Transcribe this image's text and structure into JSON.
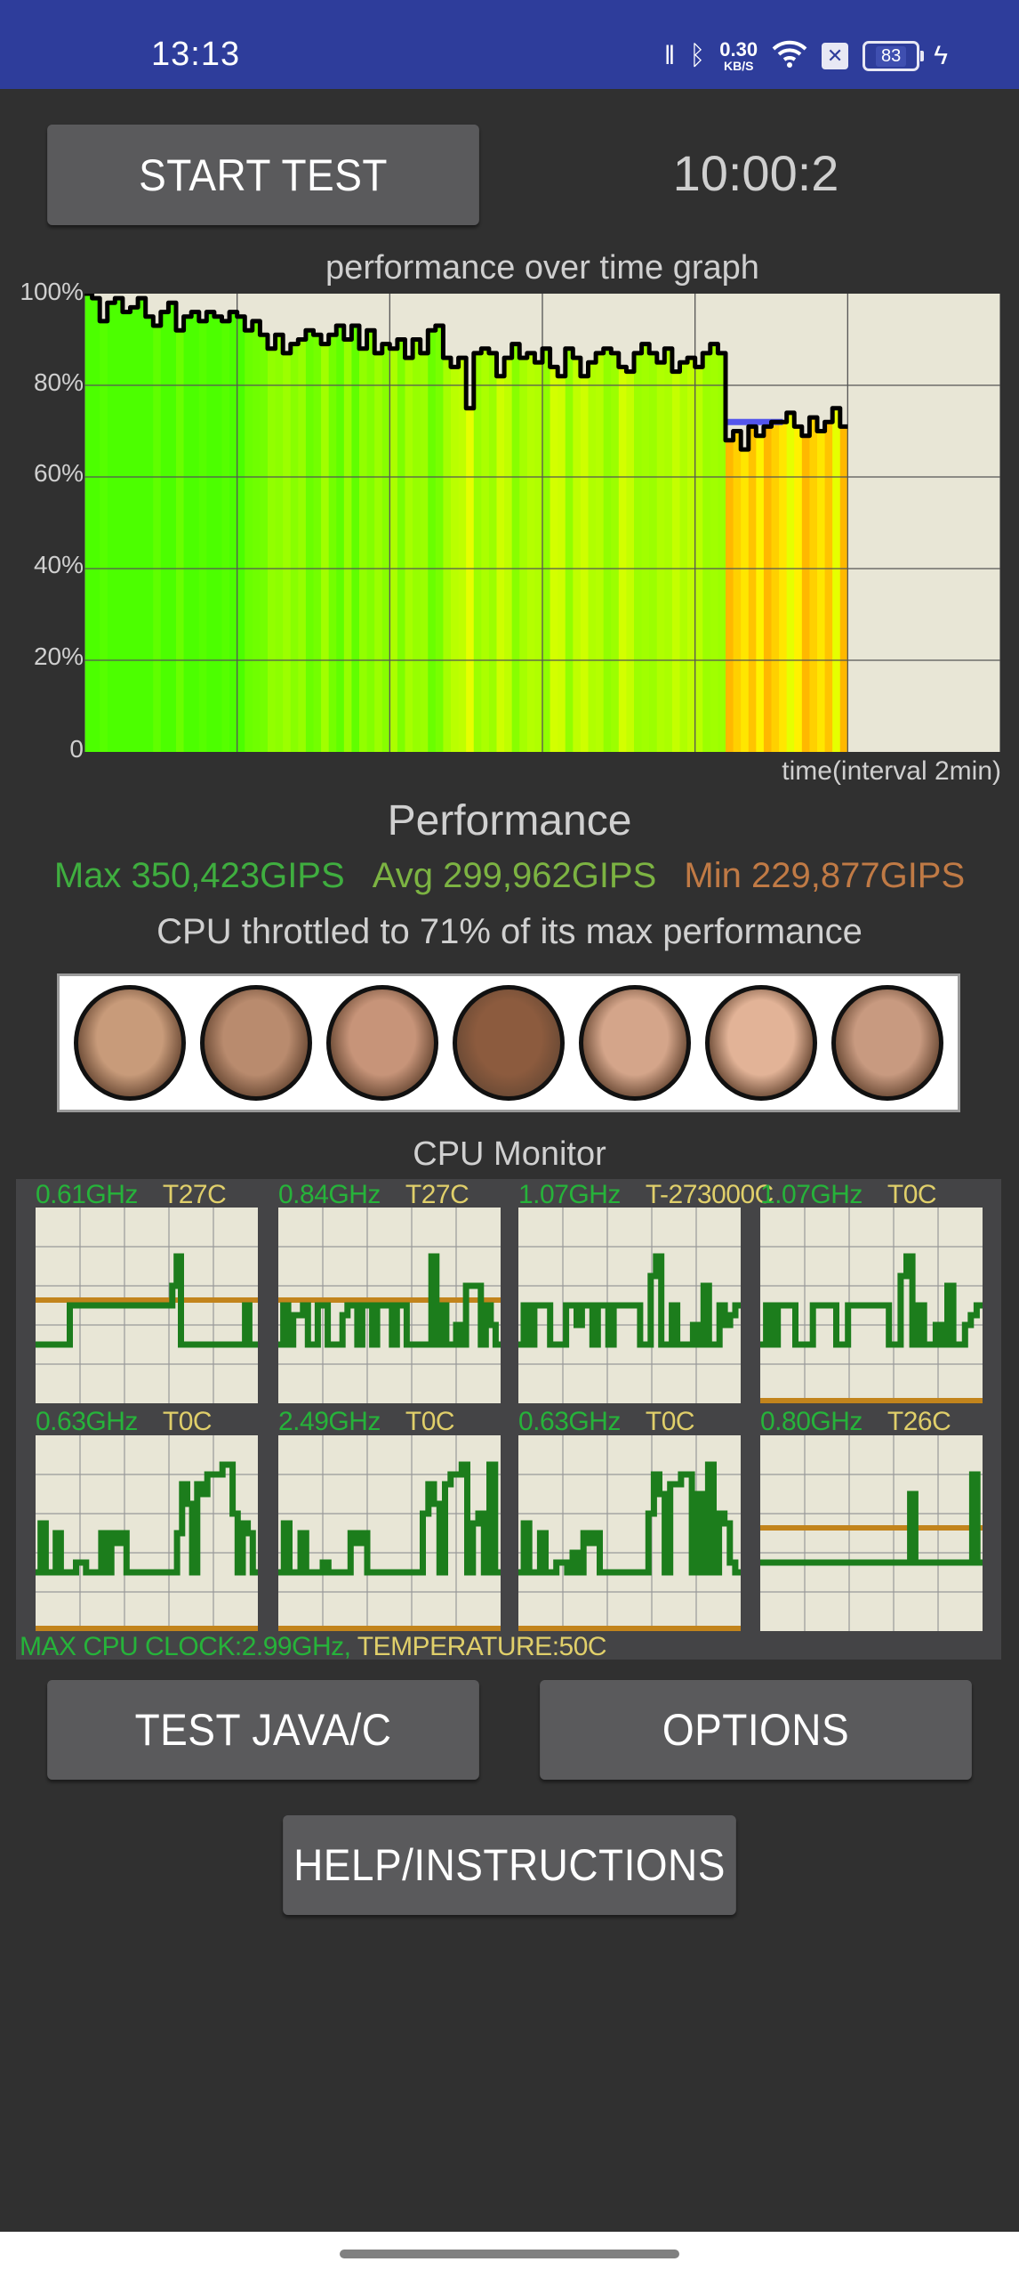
{
  "status_bar": {
    "time": "13:13",
    "net_speed_value": "0.30",
    "net_speed_unit": "KB/S",
    "battery": "83",
    "icons": [
      "vibrate-icon",
      "bluetooth-icon",
      "wifi-icon",
      "sim-x-icon",
      "battery-icon",
      "charging-bolt-icon"
    ]
  },
  "controls": {
    "start_label": "START TEST",
    "timer": "10:00:2"
  },
  "graph": {
    "title": "performance over time graph",
    "xlabel": "time(interval 2min)"
  },
  "chart_data": [
    {
      "type": "area",
      "title": "performance over time graph",
      "xlabel": "time(interval 2min)",
      "ylabel": "",
      "y_ticks": [
        "0",
        "20%",
        "40%",
        "60%",
        "80%",
        "100%"
      ],
      "ylim": [
        0,
        100
      ],
      "xlim_minutes": [
        0,
        12
      ],
      "grid": true,
      "x_minutes": [
        0,
        0.1,
        0.2,
        0.3,
        0.4,
        0.5,
        0.6,
        0.7,
        0.8,
        0.9,
        1.0,
        1.1,
        1.2,
        1.3,
        1.4,
        1.5,
        1.6,
        1.7,
        1.8,
        1.9,
        2.0,
        2.1,
        2.2,
        2.3,
        2.4,
        2.5,
        2.6,
        2.7,
        2.8,
        2.9,
        3.0,
        3.1,
        3.2,
        3.3,
        3.4,
        3.5,
        3.6,
        3.7,
        3.8,
        3.9,
        4.0,
        4.1,
        4.2,
        4.3,
        4.4,
        4.5,
        4.6,
        4.7,
        4.8,
        4.9,
        5.0,
        5.1,
        5.2,
        5.3,
        5.4,
        5.5,
        5.6,
        5.7,
        5.8,
        5.9,
        6.0,
        6.1,
        6.2,
        6.3,
        6.4,
        6.5,
        6.6,
        6.7,
        6.8,
        6.9,
        7.0,
        7.1,
        7.2,
        7.3,
        7.4,
        7.5,
        7.6,
        7.7,
        7.8,
        7.9,
        8.0,
        8.1,
        8.2,
        8.3,
        8.4,
        8.5,
        8.6,
        8.7,
        8.8,
        8.9,
        9.0,
        9.1,
        9.2,
        9.3,
        9.4,
        9.5,
        9.6,
        9.7,
        9.8,
        9.9
      ],
      "performance_percent": [
        100,
        99,
        94,
        98,
        99,
        96,
        97,
        99,
        95,
        93,
        96,
        98,
        92,
        95,
        96,
        94,
        96,
        95,
        94,
        96,
        95,
        92,
        94,
        91,
        88,
        91,
        87,
        89,
        90,
        92,
        91,
        89,
        91,
        93,
        90,
        93,
        88,
        92,
        87,
        89,
        88,
        90,
        86,
        90,
        87,
        92,
        93,
        86,
        84,
        86,
        75,
        87,
        88,
        87,
        82,
        86,
        89,
        86,
        87,
        85,
        88,
        84,
        82,
        88,
        86,
        82,
        85,
        87,
        88,
        87,
        84,
        83,
        87,
        89,
        87,
        85,
        88,
        83,
        85,
        86,
        84,
        87,
        89,
        87,
        68,
        70,
        66,
        71,
        69,
        71,
        72,
        72,
        74,
        71,
        69,
        73,
        70,
        72,
        75,
        71
      ],
      "throttled_average_percent": 72,
      "bar_color_hint": [
        "green",
        "yellow-green",
        "yellow",
        "orange"
      ]
    },
    {
      "type": "line",
      "title": "CPU Monitor",
      "cores": [
        {
          "freq": "0.61GHz",
          "temp": "T27C",
          "temp_level": 0.5,
          "freq_series": [
            0.3,
            0.3,
            0.3,
            0.3,
            0.3,
            0.3,
            0.3,
            0.3,
            0.5,
            0.5,
            0.5,
            0.5,
            0.5,
            0.5,
            0.5,
            0.5,
            0.5,
            0.5,
            0.5,
            0.5,
            0.5,
            0.5,
            0.5,
            0.5,
            0.5,
            0.5,
            0.5,
            0.5,
            0.5,
            0.5,
            0.5,
            0.5,
            0.6,
            0.75,
            0.3,
            0.3,
            0.3,
            0.3,
            0.3,
            0.3,
            0.3,
            0.3,
            0.3,
            0.3,
            0.3,
            0.3,
            0.3,
            0.3,
            0.3,
            0.5,
            0.3,
            0.3
          ]
        },
        {
          "freq": "0.84GHz",
          "temp": "T27C",
          "temp_level": 0.5,
          "freq_series": [
            0.3,
            0.5,
            0.3,
            0.45,
            0.45,
            0.5,
            0.3,
            0.3,
            0.5,
            0.5,
            0.3,
            0.3,
            0.3,
            0.45,
            0.5,
            0.5,
            0.3,
            0.5,
            0.5,
            0.3,
            0.5,
            0.5,
            0.5,
            0.3,
            0.5,
            0.5,
            0.3,
            0.3,
            0.3,
            0.3,
            0.3,
            0.75,
            0.3,
            0.5,
            0.3,
            0.3,
            0.4,
            0.3,
            0.6,
            0.6,
            0.6,
            0.3,
            0.5,
            0.4,
            0.3
          ]
        },
        {
          "freq": "1.07GHz",
          "temp": "T-273000C",
          "temp_level": null,
          "freq_series": [
            0.3,
            0.5,
            0.3,
            0.5,
            0.5,
            0.5,
            0.3,
            0.3,
            0.3,
            0.5,
            0.5,
            0.4,
            0.5,
            0.5,
            0.3,
            0.5,
            0.5,
            0.3,
            0.5,
            0.5,
            0.5,
            0.5,
            0.5,
            0.3,
            0.3,
            0.65,
            0.75,
            0.3,
            0.3,
            0.5,
            0.3,
            0.3,
            0.3,
            0.4,
            0.3,
            0.6,
            0.3,
            0.3,
            0.5,
            0.4,
            0.45,
            0.5
          ]
        },
        {
          "freq": "1.07GHz",
          "temp": "T0C",
          "temp_level": 0.0,
          "freq_series": [
            0.3,
            0.5,
            0.3,
            0.5,
            0.5,
            0.5,
            0.3,
            0.3,
            0.3,
            0.5,
            0.5,
            0.5,
            0.5,
            0.3,
            0.3,
            0.5,
            0.5,
            0.5,
            0.5,
            0.5,
            0.5,
            0.5,
            0.3,
            0.3,
            0.65,
            0.75,
            0.3,
            0.5,
            0.3,
            0.3,
            0.4,
            0.3,
            0.6,
            0.3,
            0.3,
            0.4,
            0.45,
            0.5
          ]
        },
        {
          "freq": "0.63GHz",
          "temp": "T0C",
          "temp_level": 0.0,
          "freq_series": [
            0.3,
            0.55,
            0.3,
            0.3,
            0.5,
            0.3,
            0.3,
            0.3,
            0.35,
            0.35,
            0.3,
            0.3,
            0.3,
            0.5,
            0.3,
            0.5,
            0.45,
            0.5,
            0.3,
            0.3,
            0.3,
            0.3,
            0.3,
            0.3,
            0.3,
            0.3,
            0.3,
            0.3,
            0.5,
            0.75,
            0.65,
            0.3,
            0.75,
            0.7,
            0.8,
            0.8,
            0.8,
            0.85,
            0.85,
            0.6,
            0.3,
            0.55,
            0.5,
            0.3
          ]
        },
        {
          "freq": "2.49GHz",
          "temp": "T0C",
          "temp_level": 0.0,
          "freq_series": [
            0.3,
            0.55,
            0.3,
            0.3,
            0.5,
            0.3,
            0.3,
            0.3,
            0.35,
            0.3,
            0.3,
            0.3,
            0.3,
            0.5,
            0.45,
            0.5,
            0.3,
            0.3,
            0.3,
            0.3,
            0.3,
            0.3,
            0.3,
            0.3,
            0.3,
            0.3,
            0.6,
            0.75,
            0.65,
            0.3,
            0.75,
            0.8,
            0.8,
            0.85,
            0.3,
            0.55,
            0.6,
            0.3,
            0.85,
            0.3
          ]
        },
        {
          "freq": "0.63GHz",
          "temp": "T0C",
          "temp_level": 0.0,
          "freq_series": [
            0.3,
            0.55,
            0.3,
            0.3,
            0.5,
            0.3,
            0.3,
            0.35,
            0.35,
            0.3,
            0.4,
            0.3,
            0.5,
            0.45,
            0.5,
            0.3,
            0.3,
            0.3,
            0.3,
            0.3,
            0.3,
            0.3,
            0.3,
            0.3,
            0.6,
            0.8,
            0.7,
            0.3,
            0.75,
            0.75,
            0.8,
            0.8,
            0.3,
            0.7,
            0.3,
            0.85,
            0.3,
            0.6,
            0.55,
            0.35,
            0.3
          ]
        },
        {
          "freq": "0.80GHz",
          "temp": "T26C",
          "temp_level": 0.5,
          "freq_series": [
            0.35,
            0.35,
            0.35,
            0.35,
            0.35,
            0.35,
            0.35,
            0.35,
            0.35,
            0.35,
            0.35,
            0.35,
            0.35,
            0.35,
            0.35,
            0.35,
            0.35,
            0.35,
            0.35,
            0.35,
            0.35,
            0.35,
            0.35,
            0.35,
            0.35,
            0.35,
            0.35,
            0.35,
            0.35,
            0.7,
            0.35,
            0.35,
            0.35,
            0.35,
            0.35,
            0.35,
            0.35,
            0.35,
            0.35,
            0.35,
            0.35,
            0.8,
            0.35
          ]
        }
      ]
    }
  ],
  "performance": {
    "title": "Performance",
    "max": "Max 350,423GIPS",
    "avg": "Avg 299,962GIPS",
    "min": "Min 229,877GIPS",
    "throttle_text": "CPU throttled to 71% of its max performance",
    "colors": {
      "max": "#3fae3f",
      "avg": "#7cb342",
      "min": "#c07a45"
    }
  },
  "faces_strip": {
    "count": 7,
    "tones": [
      "#c89b7a",
      "#b98b6e",
      "#c79479",
      "#8c5b3e",
      "#d4a58a",
      "#e2b397",
      "#c89a80"
    ]
  },
  "cpu_monitor": {
    "title": "CPU Monitor",
    "footer_clock": "MAX CPU CLOCK:2.99GHz,",
    "footer_temp": " TEMPERATURE:50C",
    "colors": {
      "freq_text": "#26b33a",
      "temp_text": "#e0cf6a",
      "freq_line": "#1c7d1c",
      "temp_line": "#c2841c",
      "grid_bg": "#e8e6d6"
    }
  },
  "buttons": {
    "test_java_c": "TEST JAVA/C",
    "options": "OPTIONS",
    "help": "HELP/INSTRUCTIONS"
  }
}
